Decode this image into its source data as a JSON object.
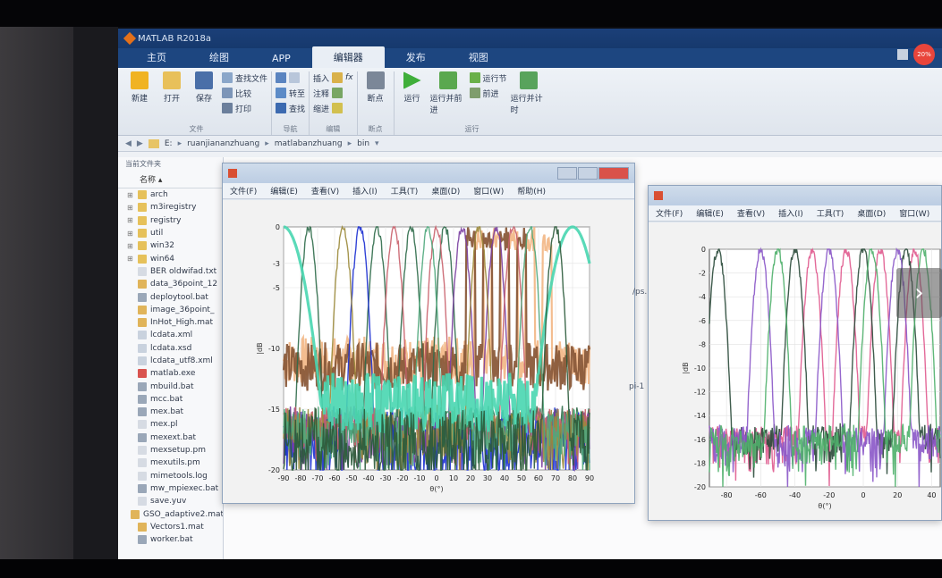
{
  "window": {
    "title": "MATLAB R2018a"
  },
  "tabs": [
    {
      "label": "主页",
      "active": false
    },
    {
      "label": "绘图",
      "active": false
    },
    {
      "label": "APP",
      "active": false
    },
    {
      "label": "编辑器",
      "active": true
    },
    {
      "label": "发布",
      "active": false
    },
    {
      "label": "视图",
      "active": false
    }
  ],
  "status_badge": "20%",
  "ribbon": {
    "file": {
      "name": "文件",
      "new": "新建",
      "open": "打开",
      "save": "保存",
      "find_files": "查找文件",
      "compare": "比较",
      "print": "打印"
    },
    "nav": {
      "name": "导航",
      "goto": "转至",
      "find": "查找"
    },
    "edit": {
      "name": "编辑",
      "insert": "插入",
      "comment": "注释",
      "indent": "缩进"
    },
    "breakpoints": {
      "name": "断点",
      "label": "断点"
    },
    "run": {
      "name": "运行",
      "run": "运行",
      "run_advance": "运行并前进",
      "run_section": "运行节",
      "advance": "前进",
      "run_time": "运行并计时"
    }
  },
  "path": {
    "segments": [
      "E:",
      "ruanjiananzhuang",
      "matlabanzhuang",
      "bin"
    ]
  },
  "browser": {
    "header": "当前文件夹",
    "column": "名称 ▴",
    "items": [
      {
        "name": "arch",
        "type": "folder"
      },
      {
        "name": "m3iregistry",
        "type": "folder"
      },
      {
        "name": "registry",
        "type": "folder"
      },
      {
        "name": "util",
        "type": "folder"
      },
      {
        "name": "win32",
        "type": "folder"
      },
      {
        "name": "win64",
        "type": "folder"
      },
      {
        "name": "BER oldwifad.txt",
        "type": "txt"
      },
      {
        "name": "data_36point_12",
        "type": "mat"
      },
      {
        "name": "deploytool.bat",
        "type": "bat"
      },
      {
        "name": "image_36point_",
        "type": "mat"
      },
      {
        "name": "InHot_High.mat",
        "type": "mat"
      },
      {
        "name": "lcdata.xml",
        "type": "xml"
      },
      {
        "name": "lcdata.xsd",
        "type": "xml"
      },
      {
        "name": "lcdata_utf8.xml",
        "type": "xml"
      },
      {
        "name": "matlab.exe",
        "type": "exe"
      },
      {
        "name": "mbuild.bat",
        "type": "bat"
      },
      {
        "name": "mcc.bat",
        "type": "bat"
      },
      {
        "name": "mex.bat",
        "type": "bat"
      },
      {
        "name": "mex.pl",
        "type": "txt"
      },
      {
        "name": "mexext.bat",
        "type": "bat"
      },
      {
        "name": "mexsetup.pm",
        "type": "txt"
      },
      {
        "name": "mexutils.pm",
        "type": "txt"
      },
      {
        "name": "mimetools.log",
        "type": "txt"
      },
      {
        "name": "mw_mpiexec.bat",
        "type": "bat"
      },
      {
        "name": "save.yuv",
        "type": "txt"
      },
      {
        "name": "GSO_adaptive2.mat",
        "type": "mat"
      },
      {
        "name": "Vectors1.mat",
        "type": "mat"
      },
      {
        "name": "worker.bat",
        "type": "bat"
      }
    ]
  },
  "figure_menu": [
    "文件(F)",
    "编辑(E)",
    "查看(V)",
    "插入(I)",
    "工具(T)",
    "桌面(D)",
    "窗口(W)",
    "帮助(H)"
  ],
  "figure_menu_right": [
    "文件(F)",
    "编辑(E)",
    "查看(V)",
    "插入(I)",
    "工具(T)",
    "桌面(D)",
    "窗口(W)"
  ],
  "workspace_annotations": [
    "/ps.",
    "pi-1"
  ],
  "chart_data": [
    {
      "type": "line",
      "x_ticks": [
        -90,
        -80,
        -70,
        -60,
        -50,
        -40,
        -30,
        -20,
        -10,
        0,
        10,
        20,
        30,
        40,
        50,
        60,
        70,
        80,
        90
      ],
      "y_ticks": [
        0,
        -3,
        -5,
        -10,
        -15,
        -20
      ],
      "xlim": [
        -90,
        90
      ],
      "ylim": [
        -20,
        0
      ],
      "xlabel": "θ(°)",
      "ylabel": "|dB",
      "grid": true,
      "series": [
        {
          "color": "#f2b98a",
          "shape": "floor",
          "floor": -11,
          "peaks": [
            25,
            35,
            45,
            55,
            65
          ]
        },
        {
          "color": "#8a5a3a",
          "shape": "floor",
          "floor": -11.5,
          "peaks": [
            20,
            30,
            40,
            50
          ]
        },
        {
          "color": "#2f6b4a",
          "shape": "beams",
          "peaks": [
            -75,
            -35,
            -15,
            5
          ]
        },
        {
          "color": "#1b2fd1",
          "shape": "beams",
          "peaks": [
            -45
          ]
        },
        {
          "color": "#7a3ea0",
          "shape": "beams",
          "peaks": [
            15,
            35
          ]
        },
        {
          "color": "#c9616b",
          "shape": "beams",
          "peaks": [
            -25,
            0,
            45
          ]
        },
        {
          "color": "#9b8a3a",
          "shape": "beams",
          "peaks": [
            -55,
            25
          ]
        },
        {
          "color": "#4fa87c",
          "shape": "beams",
          "peaks": [
            -5,
            55
          ]
        },
        {
          "color": "#48d6b0",
          "shape": "cover",
          "peaks": [
            -90,
            80
          ]
        },
        {
          "color": "#2a5a3a",
          "shape": "single",
          "peaks": [
            70
          ]
        }
      ]
    },
    {
      "type": "line",
      "x_ticks": [
        -80,
        -60,
        -40,
        -20,
        0,
        20,
        40
      ],
      "y_ticks": [
        0,
        -2,
        -4,
        -6,
        -8,
        -10,
        -12,
        -14,
        -16,
        -18,
        -20
      ],
      "xlim": [
        -90,
        45
      ],
      "ylim": [
        -20,
        0
      ],
      "xlabel": "θ(°)",
      "ylabel": "|dB",
      "grid": true,
      "series": [
        {
          "color": "#e05a8e",
          "shape": "beams",
          "peaks": [
            -30,
            -10,
            10,
            30
          ]
        },
        {
          "color": "#2a4a3a",
          "shape": "beams",
          "peaks": [
            -85,
            -40,
            0,
            25
          ]
        },
        {
          "color": "#8a57c8",
          "shape": "beams",
          "peaks": [
            -60,
            -20,
            20
          ]
        },
        {
          "color": "#4fb06c",
          "shape": "beams",
          "peaks": [
            -50,
            5,
            35
          ]
        }
      ]
    }
  ]
}
